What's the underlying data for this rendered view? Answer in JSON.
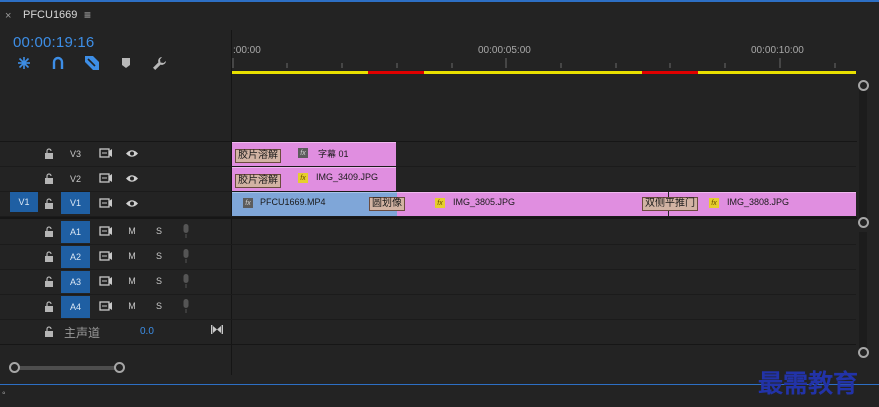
{
  "window": {
    "close_glyph": "×",
    "sequence_name": "PFCU1669",
    "menu_glyph": "≡"
  },
  "timecode": "00:00:19:16",
  "toolbar": {
    "items": [
      {
        "name": "snap-icon",
        "glyph": "⁜"
      },
      {
        "name": "linked-selection-icon",
        "glyph": "∩"
      },
      {
        "name": "add-marker-icon",
        "glyph": "▼"
      },
      {
        "name": "marker-icon",
        "glyph": "⬟"
      },
      {
        "name": "wrench-icon",
        "glyph": "🔧"
      }
    ]
  },
  "ruler": {
    "labels": [
      ":00:00",
      "00:00:05:00",
      "00:00:10:00"
    ]
  },
  "tracks": {
    "video": [
      {
        "target": "V3",
        "source": "",
        "clips_label": ""
      },
      {
        "target": "V2",
        "source": "",
        "clips_label": ""
      },
      {
        "target": "V1",
        "source": "V1",
        "clips_label": ""
      }
    ],
    "audio": [
      {
        "target": "A1",
        "mute": "M",
        "solo": "S"
      },
      {
        "target": "A2",
        "mute": "M",
        "solo": "S"
      },
      {
        "target": "A3",
        "mute": "M",
        "solo": "S"
      },
      {
        "target": "A4",
        "mute": "M",
        "solo": "S"
      }
    ],
    "master": {
      "label": "主声道",
      "value": "0.0"
    }
  },
  "clips": {
    "v3": {
      "transition": "胶片溶解",
      "name": "字幕 01"
    },
    "v2": {
      "transition": "胶片溶解",
      "name": "IMG_3409.JPG"
    },
    "v1": {
      "video_name": "PFCU1669.MP4",
      "transition1": "圆划像",
      "clip2_name": "IMG_3805.JPG",
      "transition2": "双侧平推门",
      "clip3_name": "IMG_3808.JPG"
    },
    "fx_label": "fx"
  },
  "status": {
    "indicator": "◦"
  },
  "watermark": "最需教育",
  "colors": {
    "accent": "#3d8ee6",
    "patch": "#1f5fa3",
    "clip_pink": "#e08ee0",
    "clip_blue": "#7fa6d8",
    "work_area": "#e8e000",
    "render_red": "#e00000"
  }
}
